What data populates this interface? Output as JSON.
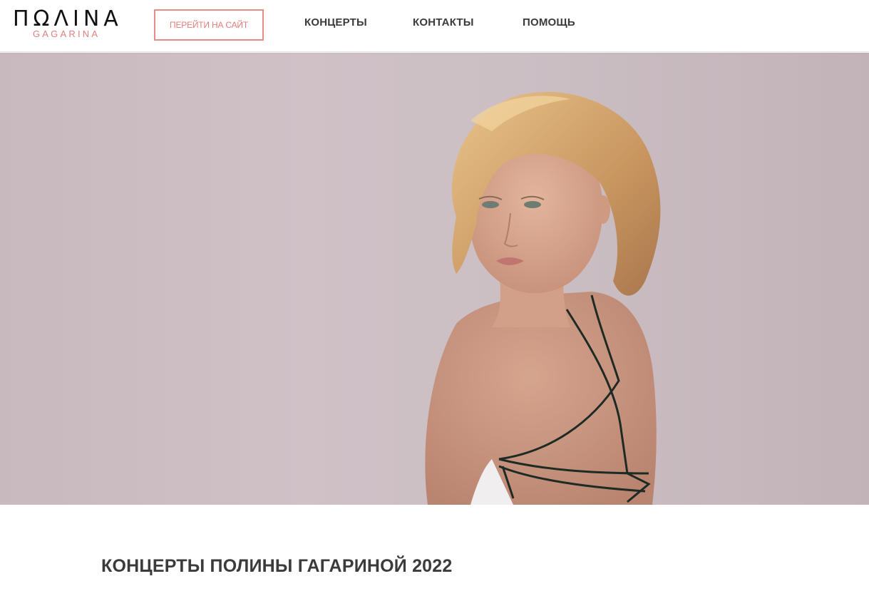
{
  "header": {
    "logo": {
      "top_text": "ΠΩΛΙΝΑ",
      "bottom_text": "GAGARINA"
    },
    "cta_label": "ПЕРЕЙТИ НА САЙТ",
    "nav": [
      {
        "label": "КОНЦЕРТЫ"
      },
      {
        "label": "КОНТАКТЫ"
      },
      {
        "label": "ПОМОЩЬ"
      }
    ]
  },
  "hero": {
    "image": "portrait photo of a blonde woman looking over her shoulder against a pale pink wall"
  },
  "main": {
    "section_title": "КОНЦЕРТЫ ПОЛИНЫ ГАГАРИНОЙ 2022"
  },
  "colors": {
    "accent": "#e88a85",
    "text": "#3a3a3a",
    "hero_bg": "#cbbfc4"
  }
}
